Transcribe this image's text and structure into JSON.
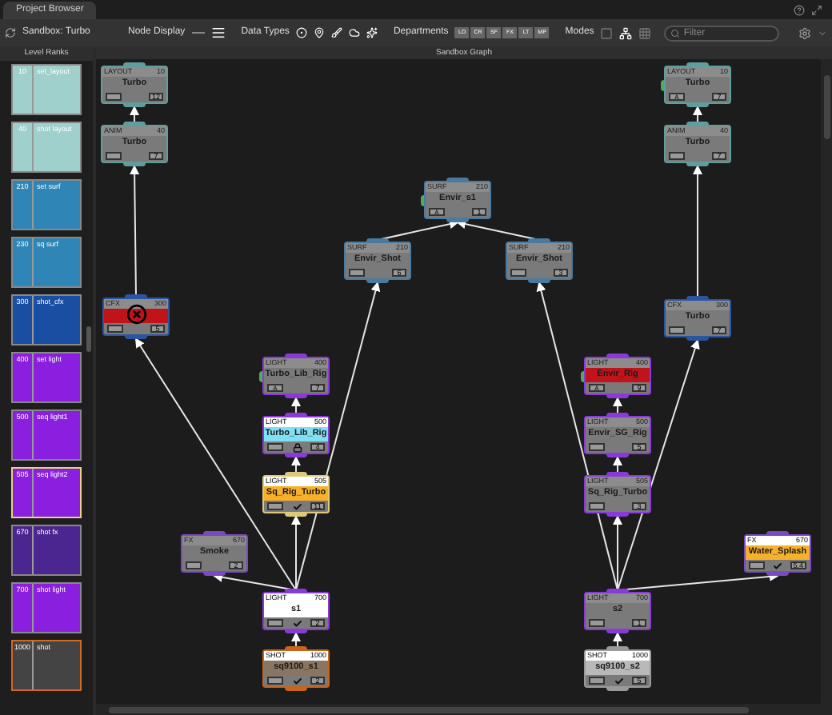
{
  "tab": "Project Browser",
  "toolbar": {
    "sandbox": "Sandbox: Turbo",
    "node_display": "Node Display",
    "data_types": "Data Types",
    "departments_label": "Departments",
    "departments": [
      "LO",
      "CR",
      "SF",
      "FX",
      "LT",
      "MP"
    ],
    "modes": "Modes",
    "filter": {
      "placeholder": "Filter"
    }
  },
  "level_ranks": {
    "title": "Level Ranks",
    "items": [
      {
        "rank": "10",
        "name": "set_layout",
        "color": "#9fd0cc",
        "kind": "plain"
      },
      {
        "rank": "40",
        "name": "shot layout",
        "color": "#9fd0cc",
        "kind": "plain"
      },
      {
        "rank": "210",
        "name": "set surf",
        "color": "#2f86b6",
        "kind": "plain"
      },
      {
        "rank": "230",
        "name": "sq surf",
        "color": "#2f86b6",
        "kind": "plain"
      },
      {
        "rank": "300",
        "name": "shot_cfx",
        "color": "#1a4ea2",
        "kind": "plain"
      },
      {
        "rank": "400",
        "name": "set light",
        "color": "#8a1fe0",
        "kind": "plain"
      },
      {
        "rank": "500",
        "name": "seq light1",
        "color": "#8a1fe0",
        "kind": "plain"
      },
      {
        "rank": "505",
        "name": "seq light2",
        "color": "#8a1fe0",
        "kind": "selected"
      },
      {
        "rank": "670",
        "name": "shot fx",
        "color": "#4b2690",
        "kind": "plain"
      },
      {
        "rank": "700",
        "name": "shot light",
        "color": "#8a1fe0",
        "kind": "plain"
      },
      {
        "rank": "1000",
        "name": "shot",
        "color": "#444444",
        "kind": "current"
      }
    ]
  },
  "graph": {
    "title": "Sandbox Graph",
    "nodes": [
      {
        "dept": "LAYOUT",
        "rank": "10",
        "name": "Turbo",
        "color": "#7a7a7a",
        "highlighted": false,
        "flagged": false,
        "selected": false,
        "kind": "plain",
        "badge": "12"
      },
      {
        "dept": "ANIM",
        "rank": "40",
        "name": "Turbo",
        "color": "#7a7a7a",
        "highlighted": false,
        "flagged": false,
        "selected": false,
        "kind": "plain",
        "badge": "7"
      },
      {
        "dept": "CFX",
        "rank": "300",
        "color": "#c0141a",
        "highlighted": false,
        "flagged": false,
        "selected": false,
        "kind": "error",
        "badge": "5"
      },
      {
        "dept": "SURF",
        "rank": "210",
        "name": "Envir_s1",
        "color": "#7a7a7a",
        "highlighted": false,
        "flagged": true,
        "selected": false,
        "kind": "plain",
        "left_label": "A",
        "badge": "1"
      },
      {
        "dept": "SURF",
        "rank": "210",
        "name": "Envir_Shot",
        "color": "#7a7a7a",
        "highlighted": false,
        "flagged": false,
        "selected": false,
        "kind": "plain",
        "badge": "6"
      },
      {
        "dept": "SURF",
        "rank": "210",
        "name": "Envir_Shot",
        "color": "#7a7a7a",
        "highlighted": false,
        "flagged": false,
        "selected": false,
        "kind": "plain",
        "badge": "3"
      },
      {
        "dept": "LAYOUT",
        "rank": "10",
        "name": "Turbo",
        "color": "#7a7a7a",
        "highlighted": false,
        "flagged": true,
        "selected": false,
        "kind": "plain",
        "left_label": "A",
        "badge": "7"
      },
      {
        "dept": "ANIM",
        "rank": "40",
        "name": "Turbo",
        "color": "#7a7a7a",
        "highlighted": false,
        "flagged": false,
        "selected": false,
        "kind": "plain",
        "badge": "7"
      },
      {
        "dept": "CFX",
        "rank": "300",
        "name": "Turbo",
        "color": "#7a7a7a",
        "highlighted": false,
        "flagged": false,
        "selected": false,
        "kind": "plain",
        "badge": "7"
      },
      {
        "dept": "LIGHT",
        "rank": "400",
        "name": "Turbo_Lib_Rig",
        "color": "#7a7a7a",
        "highlighted": false,
        "flagged": true,
        "selected": false,
        "kind": "plain",
        "left_label": "A",
        "badge": "7"
      },
      {
        "dept": "LIGHT",
        "rank": "500",
        "name": "Turbo_Lib_Rig",
        "color": "#7fe0f5",
        "highlighted": true,
        "flagged": false,
        "selected": false,
        "kind": "locked",
        "badge": "4"
      },
      {
        "dept": "LIGHT",
        "rank": "505",
        "name": "Sq_Rig_Turbo",
        "color": "#f7b02a",
        "highlighted": true,
        "flagged": false,
        "selected": true,
        "kind": "checked",
        "badge": "11"
      },
      {
        "dept": "FX",
        "rank": "670",
        "name": "Smoke",
        "color": "#7a7a7a",
        "highlighted": false,
        "flagged": false,
        "selected": false,
        "kind": "plain",
        "badge": "2"
      },
      {
        "dept": "LIGHT",
        "rank": "700",
        "name": "s1",
        "color": "#ffffff",
        "highlighted": true,
        "flagged": false,
        "selected": false,
        "kind": "checked",
        "badge": "2"
      },
      {
        "dept": "SHOT",
        "rank": "1000",
        "name": "sq9100_s1",
        "color": "#8a7560",
        "highlighted": true,
        "flagged": false,
        "selected": true,
        "kind": "checked",
        "badge": "2"
      },
      {
        "dept": "LIGHT",
        "rank": "400",
        "name": "Envir_Rig",
        "color": "#c0141a",
        "highlighted": false,
        "flagged": true,
        "selected": false,
        "kind": "plain",
        "left_label": "A",
        "badge": "9"
      },
      {
        "dept": "LIGHT",
        "rank": "500",
        "name": "Envir_SG_Rig",
        "color": "#7a7a7a",
        "highlighted": false,
        "flagged": false,
        "selected": false,
        "kind": "plain",
        "badge": "5"
      },
      {
        "dept": "LIGHT",
        "rank": "505",
        "name": "Sq_Rig_Turbo",
        "color": "#7a7a7a",
        "highlighted": false,
        "flagged": false,
        "selected": false,
        "kind": "plain",
        "badge": "3"
      },
      {
        "dept": "LIGHT",
        "rank": "700",
        "name": "s2",
        "color": "#7a7a7a",
        "highlighted": false,
        "flagged": false,
        "selected": false,
        "kind": "plain",
        "badge": "1"
      },
      {
        "dept": "SHOT",
        "rank": "1000",
        "name": "sq9100_s2",
        "color": "#b9b9b9",
        "highlighted": true,
        "flagged": false,
        "selected": false,
        "kind": "checked",
        "badge": "5"
      },
      {
        "dept": "FX",
        "rank": "670",
        "name": "Water_Splash",
        "color": "#f7b02a",
        "highlighted": true,
        "flagged": false,
        "selected": false,
        "kind": "checked",
        "badge": "5.4"
      }
    ]
  }
}
